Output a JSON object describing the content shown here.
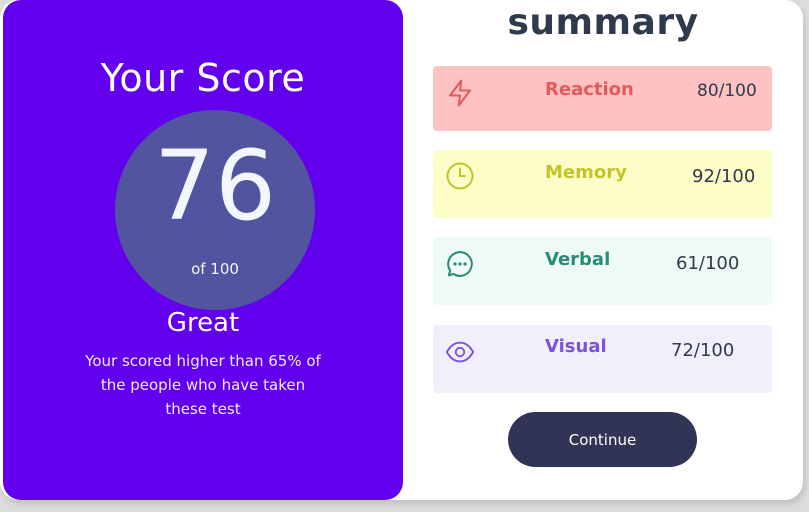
{
  "score_panel": {
    "heading": "Your Score",
    "score": "76",
    "out_of": "of 100",
    "rating": "Great",
    "description": "Your scored higher than 65% of the people who have taken these test",
    "background_color": "#6200ee",
    "circle_color": "#52549f"
  },
  "summary": {
    "title": "summary",
    "items": [
      {
        "label": "Reaction",
        "value": "80/100",
        "icon": "lightning-icon",
        "color": "#e45a5a",
        "background": "#ffc2c2"
      },
      {
        "label": "Memory",
        "value": "92/100",
        "icon": "clock-icon",
        "color": "#c4c42a",
        "background": "#fdfdc8"
      },
      {
        "label": "Verbal",
        "value": "61/100",
        "icon": "chat-bubble-icon",
        "color": "#2b8a78",
        "background": "#eefaf6"
      },
      {
        "label": "Visual",
        "value": "72/100",
        "icon": "eye-icon",
        "color": "#7a55d6",
        "background": "#f2effc"
      }
    ]
  },
  "continue_button": {
    "label": "Continue",
    "color": "#313454"
  }
}
